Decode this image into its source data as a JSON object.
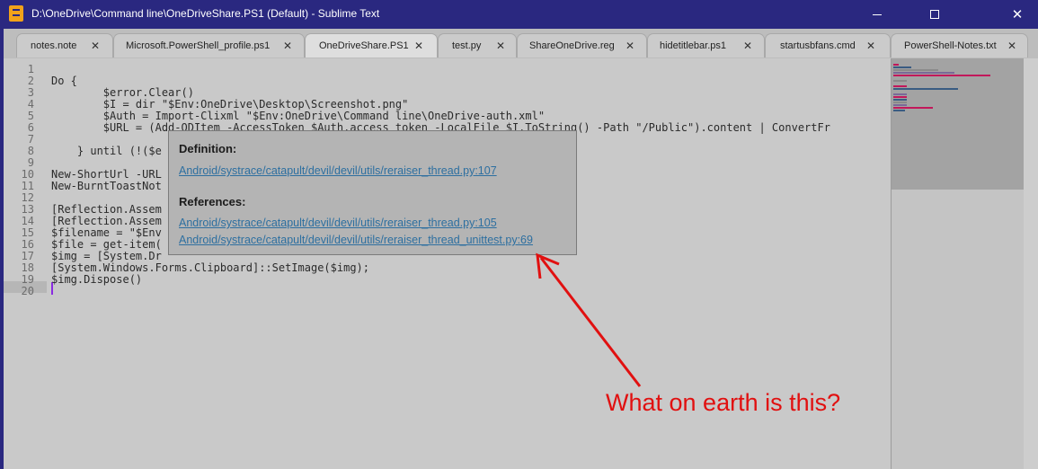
{
  "window": {
    "title": "D:\\OneDrive\\Command line\\OneDriveShare.PS1 (Default) - Sublime Text",
    "minimize_glyph": "",
    "maximize_glyph": "",
    "close_glyph": "✕"
  },
  "tabs": [
    {
      "label": "notes.note",
      "close": "✕",
      "active": false
    },
    {
      "label": "Microsoft.PowerShell_profile.ps1",
      "close": "✕",
      "active": false
    },
    {
      "label": "OneDriveShare.PS1",
      "close": "✕",
      "active": true
    },
    {
      "label": "test.py",
      "close": "✕",
      "active": false
    },
    {
      "label": "ShareOneDrive.reg",
      "close": "✕",
      "active": false
    },
    {
      "label": "hidetitlebar.ps1",
      "close": "✕",
      "active": false
    },
    {
      "label": "startusbfans.cmd",
      "close": "✕",
      "active": false
    },
    {
      "label": "PowerShell-Notes.txt",
      "close": "✕",
      "active": false
    }
  ],
  "editor": {
    "line_numbers": [
      "1",
      "2",
      "3",
      "4",
      "5",
      "6",
      "7",
      "8",
      "9",
      "10",
      "11",
      "12",
      "13",
      "14",
      "15",
      "16",
      "17",
      "18",
      "19",
      "20"
    ],
    "lines": [
      "",
      "Do {",
      "        $error.Clear()",
      "        $I = dir \"$Env:OneDrive\\Desktop\\Screenshot.png\"",
      "        $Auth = Import-Clixml \"$Env:OneDrive\\Command line\\OneDrive-auth.xml\"",
      "        $URL = (Add-ODItem -AccessToken $Auth.access_token -LocalFile $I.ToString() -Path \"/Public\").content | ConvertFr",
      "",
      "    } until (!($e",
      "",
      "New-ShortUrl -URL",
      "New-BurntToastNot                                                  -AppLogo \"$I\"",
      "",
      "[Reflection.Assem",
      "[Reflection.Assem",
      "$filename = \"$Env",
      "$file = get-item(",
      "$img = [System.Dr",
      "[System.Windows.Forms.Clipboard]::SetImage($img);",
      "$img.Dispose()",
      ""
    ]
  },
  "popup": {
    "definition_heading": "Definition:",
    "definition_link": "Android/systrace/catapult/devil/devil/utils/reraiser_thread.py:107",
    "references_heading": "References:",
    "reference_links": [
      "Android/systrace/catapult/devil/devil/utils/reraiser_thread.py:105",
      "Android/systrace/catapult/devil/devil/utils/reraiser_thread_unittest.py:69"
    ]
  },
  "annotation": {
    "text": "What on earth is this?",
    "color": "#e11010"
  },
  "colors": {
    "titlebar": "#2a2880",
    "editor_bg": "#c9c9c9",
    "link": "#2d6fa0",
    "cursor": "#8a2be2"
  }
}
